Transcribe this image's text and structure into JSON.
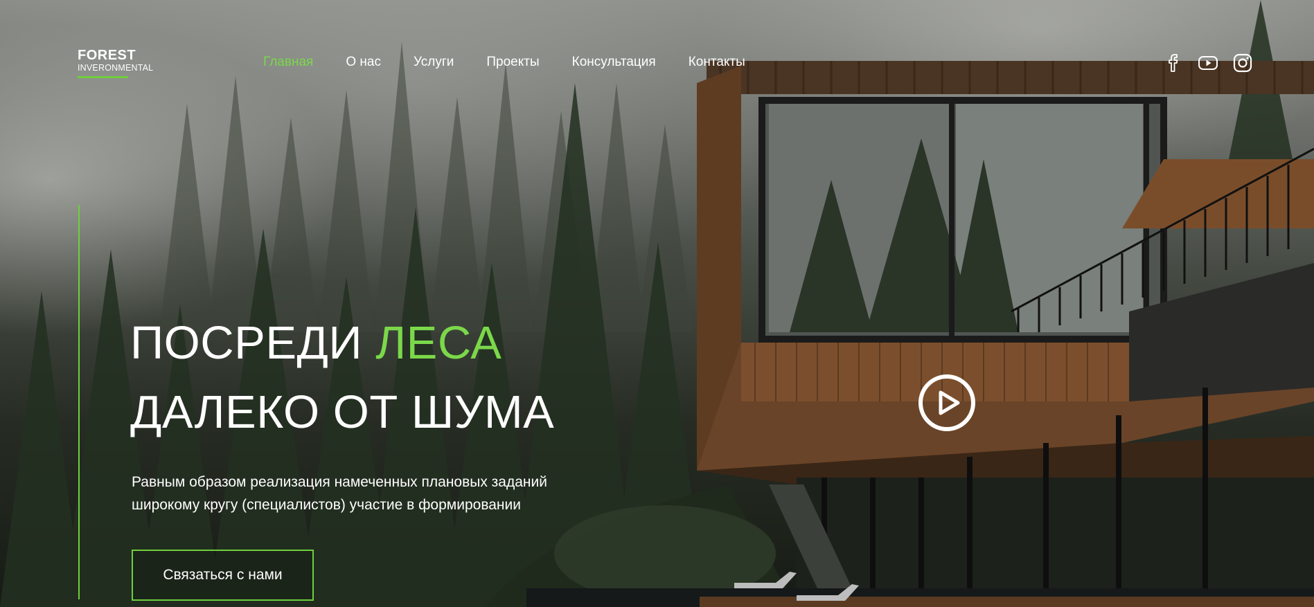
{
  "logo": {
    "title": "FOREST",
    "subtitle": "INVERONMENTAL"
  },
  "nav": {
    "items": [
      {
        "label": "Главная",
        "active": true
      },
      {
        "label": "О нас",
        "active": false
      },
      {
        "label": "Услуги",
        "active": false
      },
      {
        "label": "Проекты",
        "active": false
      },
      {
        "label": "Консультация",
        "active": false
      },
      {
        "label": "Контакты",
        "active": false
      }
    ]
  },
  "social": {
    "icons": [
      "facebook-icon",
      "youtube-icon",
      "instagram-icon"
    ]
  },
  "hero": {
    "title_line1_main": "ПОСРЕДИ",
    "title_line1_accent": "ЛЕСА",
    "title_line2": "ДАЛЕКО ОТ ШУМА",
    "text_line1": "Равным образом реализация намеченных плановых заданий",
    "text_line2": "широкому кругу (специалистов) участие в формировании",
    "cta_label": "Связаться с нами",
    "play_icon": "play-icon"
  },
  "colors": {
    "accent": "#7bd84a",
    "text": "#ffffff"
  }
}
